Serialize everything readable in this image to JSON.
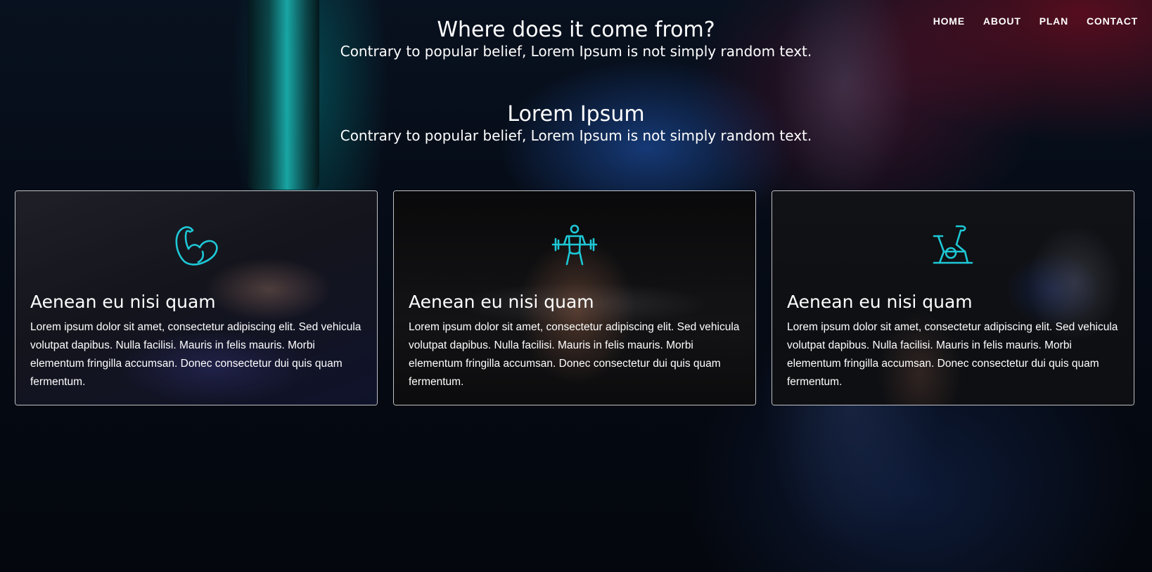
{
  "nav": {
    "items": [
      {
        "label": "HOME"
      },
      {
        "label": "ABOUT"
      },
      {
        "label": "PLAN"
      },
      {
        "label": "CONTACT"
      }
    ]
  },
  "hero": {
    "title": "Where does it come from?",
    "subtitle": "Contrary to popular belief, Lorem Ipsum is not simply random text."
  },
  "section": {
    "title": "Lorem Ipsum",
    "subtitle": "Contrary to popular belief, Lorem Ipsum is not simply random text."
  },
  "cards": [
    {
      "icon": "flexed-bicep-icon",
      "title": "Aenean eu nisi quam",
      "text": "Lorem ipsum dolor sit amet, consectetur adipiscing elit. Sed vehicula volutpat dapibus. Nulla facilisi. Mauris in felis mauris. Morbi elementum fringilla accumsan. Donec consectetur dui quis quam fermentum."
    },
    {
      "icon": "weightlifter-icon",
      "title": "Aenean eu nisi quam",
      "text": "Lorem ipsum dolor sit amet, consectetur adipiscing elit. Sed vehicula volutpat dapibus. Nulla facilisi. Mauris in felis mauris. Morbi elementum fringilla accumsan. Donec consectetur dui quis quam fermentum."
    },
    {
      "icon": "exercise-bike-icon",
      "title": "Aenean eu nisi quam",
      "text": "Lorem ipsum dolor sit amet, consectetur adipiscing elit. Sed vehicula volutpat dapibus. Nulla facilisi. Mauris in felis mauris. Morbi elementum fringilla accumsan. Donec consectetur dui quis quam fermentum."
    }
  ],
  "colors": {
    "accent": "#1ec8d6",
    "text": "#ffffff",
    "background": "#05080f"
  }
}
